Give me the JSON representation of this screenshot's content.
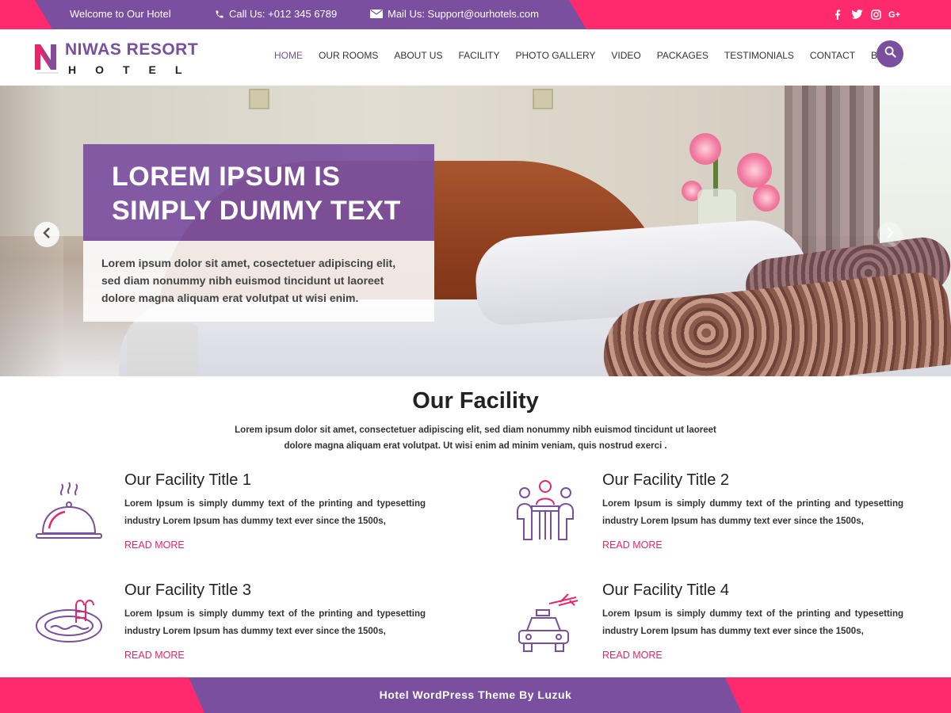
{
  "colors": {
    "accent": "#7a4f9f",
    "brand_pink": "#ff2a6d",
    "link": "#e8246a"
  },
  "topbar": {
    "welcome": "Welcome to Our Hotel",
    "call": "Call Us: +012 345 6789",
    "mail": "Mail Us: Support@ourhotels.com",
    "social": [
      {
        "icon": "facebook-icon",
        "glyph": "f"
      },
      {
        "icon": "twitter-icon",
        "glyph": "t"
      },
      {
        "icon": "instagram-icon",
        "glyph": "◎"
      },
      {
        "icon": "google-plus-icon",
        "glyph": "G+"
      }
    ]
  },
  "logo": {
    "name": "NIWAS RESORT",
    "sub": "HOTEL"
  },
  "nav": {
    "items": [
      {
        "label": "HOME",
        "active": true
      },
      {
        "label": "OUR ROOMS"
      },
      {
        "label": "ABOUT US"
      },
      {
        "label": "FACILITY"
      },
      {
        "label": "PHOTO GALLERY"
      },
      {
        "label": "VIDEO"
      },
      {
        "label": "PACKAGES"
      },
      {
        "label": "TESTIMONIALS"
      },
      {
        "label": "CONTACT"
      },
      {
        "label": "BLOG"
      }
    ]
  },
  "hero": {
    "title_line1": "LOREM IPSUM IS",
    "title_line2": "SIMPLY DUMMY TEXT",
    "text": "Lorem ipsum dolor sit amet, cosectetuer adipiscing elit, sed diam nonummy nibh euismod tincidunt ut laoreet dolore magna aliquam erat volutpat ut wisi enim."
  },
  "facility": {
    "title": "Our Facility",
    "desc": "Lorem ipsum dolor sit amet, consectetuer adipiscing elit, sed diam nonummy nibh euismod tincidunt ut laoreet dolore magna aliquam erat volutpat. Ut wisi enim ad minim veniam, quis nostrud exerci .",
    "items": [
      {
        "title": "Our Facility Title 1",
        "text": "Lorem Ipsum is simply dummy text of the printing and typesetting industry Lorem Ipsum has dummy text ever since the 1500s,",
        "link": "READ MORE",
        "icon": "food-cloche-icon"
      },
      {
        "title": "Our Facility Title 2",
        "text": "Lorem Ipsum is simply dummy text of the printing and typesetting industry Lorem Ipsum has dummy text ever since the 1500s,",
        "link": "READ MORE",
        "icon": "meeting-table-icon"
      },
      {
        "title": "Our Facility Title 3",
        "text": "Lorem Ipsum is simply dummy text of the printing and typesetting industry Lorem Ipsum has dummy text ever since the 1500s,",
        "link": "READ MORE",
        "icon": "swimming-pool-icon"
      },
      {
        "title": "Our Facility Title 4",
        "text": "Lorem Ipsum is simply dummy text of the printing and typesetting industry Lorem Ipsum has dummy text ever since the 1500s,",
        "link": "READ MORE",
        "icon": "airport-taxi-icon"
      }
    ]
  },
  "footer": {
    "credit": "Hotel WordPress Theme By Luzuk"
  }
}
